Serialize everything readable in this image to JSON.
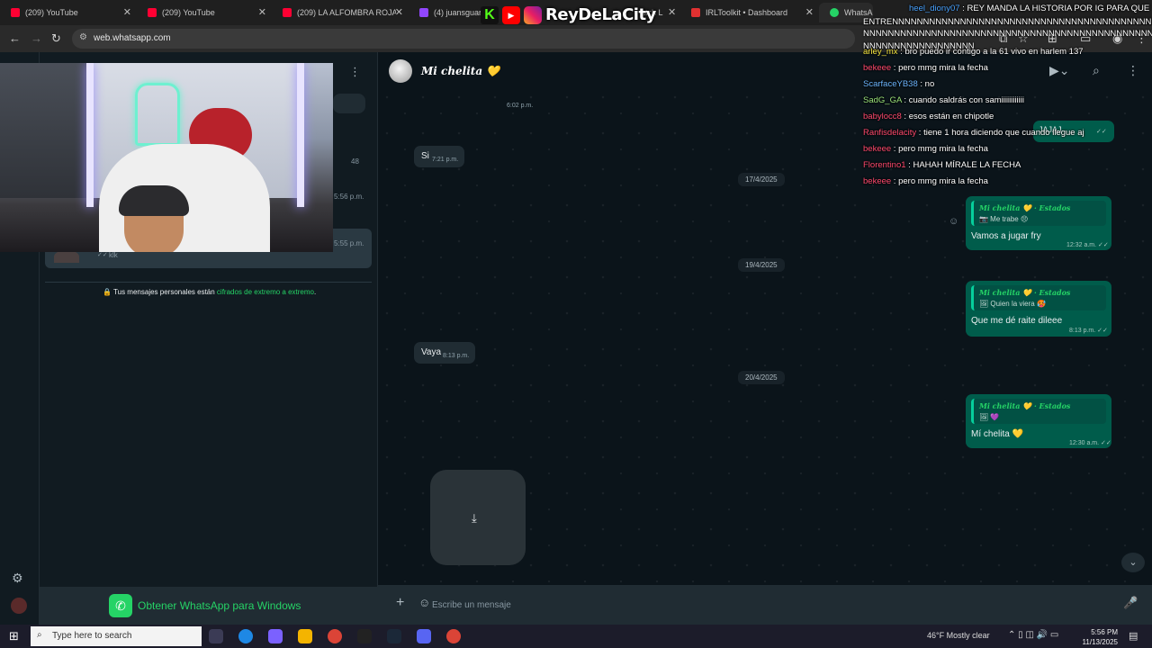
{
  "tabs": [
    {
      "label": "(209) YouTube",
      "color": "#ff0033"
    },
    {
      "label": "(209) YouTube",
      "color": "#ff0033"
    },
    {
      "label": "(209) LA ALFOMBRA ROJA -",
      "color": "#ff0033"
    },
    {
      "label": "(4) juansguarn",
      "color": "#9146ff"
    },
    {
      "label": "IRLToolkit • Dashboard",
      "color": "#e03131"
    },
    {
      "label": "WhatsApp",
      "color": "#25d366"
    }
  ],
  "partial_tab_text": "atch L",
  "stream_overlay": {
    "brand": "ReyDeLaCity"
  },
  "url": "web.whatsapp.com",
  "contact_name": "Mi chelita 💛",
  "chatlist": {
    "count": "48",
    "time1": "5:56 p.m.",
    "time2": "5:55 p.m.",
    "preview": "klk",
    "encrypted_prefix": "🔒 Tus mensajes personales están ",
    "encrypted_link": "cifrados de extremo a extremo",
    "encrypted_suffix": ".",
    "get_app": "Obtener WhatsApp para Windows"
  },
  "messages": {
    "time_top": "6:02 p.m.",
    "si_text": "Si",
    "si_time": "7:21 p.m.",
    "date1": "17/4/2025",
    "partial_out": "JAJAJ",
    "q1_name": "Mi chelita 💛 · Estados",
    "q1_sub": "📷 Me trabe 😣",
    "m1_text": "Vamos a jugar fry",
    "m1_time": "12:32 a.m. ✓✓",
    "date2": "19/4/2025",
    "q2_name": "Mi chelita 💛 · Estados",
    "q2_sub": "🖼 Quien la viera 🥵",
    "m2_text": "Que me dé raite dileee",
    "m2_time": "8:13 p.m. ✓✓",
    "vaya_text": "Vaya",
    "vaya_time": "8:13 p.m.",
    "date3": "20/4/2025",
    "q3_name": "Mi chelita 💛 · Estados",
    "q3_sub": "🖼 💜",
    "m3_text": "Mí chelita 💛",
    "m3_time": "12:30 a.m. ✓✓"
  },
  "composer_placeholder": "Escribe un mensaje",
  "chat_overlay": [
    {
      "user": "heel_diony07",
      "text": "REY MANDA LA HISTORIA POR IG PARA QUE",
      "color": "#4aa3ff"
    },
    {
      "user": "",
      "text": "ENTRENNNNNNNNNNNNNNNNNNNNNNNNNNNNNNNNNNNNNNNNNNNNNN",
      "color": "#ffffff"
    },
    {
      "user": "",
      "text": "NNNNNNNNNNNNNNNNNNNNNNNNNNNNNNNNNNNNNNNNNNNNNNNNNNNN",
      "color": "#ffffff"
    },
    {
      "user": "",
      "text": "NNNNNNNNNNNNNNNNNN",
      "color": "#ffffff"
    },
    {
      "user": "arley_mx",
      "text": "bro puedo ir contigo a la 61 vivo en harlem 137",
      "color": "#f5e642"
    },
    {
      "user": "bekeee",
      "text": "pero mmg mira la fecha",
      "color": "#ff4a6e"
    },
    {
      "user": "ScarfaceYB38",
      "text": "no",
      "color": "#6cb6ff"
    },
    {
      "user": "SadG_GA",
      "text": "cuando saldrás con samiiiiiiiiiiii",
      "color": "#9be37a"
    },
    {
      "user": "babylocc8",
      "text": "esos están en chipotle",
      "color": "#ff4a6e"
    },
    {
      "user": "Ranfisdelacity",
      "text": "tiene 1 hora diciendo que cuando llegue aj",
      "color": "#ff4a6e"
    },
    {
      "user": "bekeee",
      "text": "pero mmg mira la fecha",
      "color": "#ff4a6e"
    },
    {
      "user": "Florentino1",
      "text": "HAHAH MÍRALE LA FECHA",
      "color": "#ff4a6e"
    },
    {
      "user": "bekeee",
      "text": "pero mmg mira la fecha",
      "color": "#ff4a6e"
    }
  ],
  "taskbar": {
    "search_placeholder": "Type here to search",
    "weather": "46°F  Mostly clear",
    "time": "5:56 PM",
    "date": "11/13/2025"
  }
}
